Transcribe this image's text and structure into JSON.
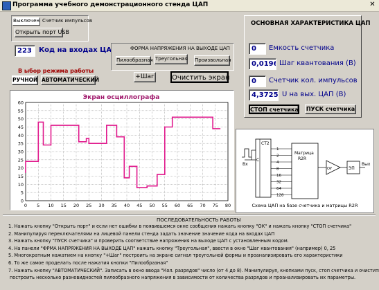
{
  "window": {
    "title": "Программа учебного демонстрационного стенда ЦАП",
    "close_glyph": "✕"
  },
  "tabs": {
    "active": "Выключен",
    "inactive": "Счетчик импульсов"
  },
  "open_port_label": "Открыть порт USB",
  "code_input": {
    "value": "223",
    "label": "Код на входах ЦАП"
  },
  "waveform": {
    "title": "ФОРМА НАПРЯЖЕНИЯ НА ВЫХОДЕ ЦАП",
    "options": [
      "Пилообразная",
      "Треугольная",
      "Произвольная"
    ]
  },
  "mode": {
    "title": "В ыбор режима работы",
    "manual": "РУЧНОЙ",
    "auto": "АВТОМАТИЧЕСКИЙ"
  },
  "step_button": "+Шаг",
  "clear_button": "Очистить экран",
  "main_char_title": "ОСНОВНАЯ ХАРАКТЕРИСТИКА ЦАП",
  "counter_capacity": {
    "value": "0",
    "label": "Емкость счетчика"
  },
  "quant_step": {
    "value": "0,01960",
    "label": "Шаг квантования (В)"
  },
  "pulse_count": {
    "value": "0",
    "label": "Счетчик кол. импульсов"
  },
  "output_voltage": {
    "value": "4,372549",
    "label": "U на вых. ЦАП (В)"
  },
  "stop_counter": "СТОП счетчика",
  "start_counter": "ПУСК счетчика",
  "circuit": {
    "input": "Вх",
    "counter": "СТ2",
    "c_pin": "С",
    "bits": [
      "1",
      "2",
      "4",
      "8",
      "16",
      "32",
      "64",
      "128"
    ],
    "matrix": "Матрица",
    "r2r": "R2R",
    "amp": "ОУ",
    "ep": "ЭП",
    "out": "Вых",
    "caption": "Схема ЦАП на базе счетчика и матрицы R2R"
  },
  "chart_data": {
    "type": "line",
    "title": "Экран осциллографа",
    "xlim": [
      0,
      80
    ],
    "ylim": [
      0,
      60
    ],
    "xticks": [
      0,
      5,
      10,
      15,
      20,
      25,
      30,
      35,
      40,
      45,
      50,
      55,
      60,
      65,
      70,
      75,
      80
    ],
    "yticks": [
      0,
      5,
      10,
      15,
      20,
      25,
      30,
      35,
      40,
      45,
      50,
      55,
      60
    ],
    "grid": true,
    "series": [
      {
        "color": "#e0188c",
        "points": [
          [
            0,
            17
          ],
          [
            0,
            24
          ],
          [
            5,
            24
          ],
          [
            5,
            40
          ],
          [
            5,
            48
          ],
          [
            7,
            48
          ],
          [
            7,
            34
          ],
          [
            10,
            34
          ],
          [
            10,
            46
          ],
          [
            21,
            46
          ],
          [
            21,
            36
          ],
          [
            24,
            36
          ],
          [
            24,
            38
          ],
          [
            25,
            38
          ],
          [
            25,
            35
          ],
          [
            32,
            35
          ],
          [
            32,
            46
          ],
          [
            36,
            46
          ],
          [
            36,
            39
          ],
          [
            39,
            39
          ],
          [
            39,
            14
          ],
          [
            41,
            14
          ],
          [
            41,
            21
          ],
          [
            44,
            21
          ],
          [
            44,
            8
          ],
          [
            48,
            8
          ],
          [
            48,
            9
          ],
          [
            52,
            9
          ],
          [
            52,
            16
          ],
          [
            55,
            16
          ],
          [
            55,
            45
          ],
          [
            58,
            45
          ],
          [
            58,
            51
          ],
          [
            74,
            51
          ],
          [
            74,
            44
          ],
          [
            77,
            44
          ]
        ]
      }
    ]
  },
  "instructions": {
    "title": "ПОСЛЕДОВАТЕЛЬНОСТЬ РАБОТЫ",
    "lines": [
      "1. Нажать кнопку \"Открыть порт\" и если нет ошибки в появившемся окне сообщения нажать кнопку \"ОК\" и нажать кнопку \"СТОП счетчика\"",
      "2. Манипулируя переключателями на лицевой панели стенда задать значение значение кода на входах ЦАП",
      "3. Нажать кнопку \"ПУСК счетчика\" и проверить соответствие напряжения на выходе ЦАП с установленным кодом.",
      "4. На панели \"ФРМА НАПРЯЖЕНИЯ НА ВЫХОДЕ ЦАП\" нажать кнопку \"Треугольная\", ввести в окно \"Шаг квантования\" (например) 0, 25",
      "5. Многократным нажатием на кнопку \"+Шаг\" построить на экране сигнал треугольной формы и проанализировать его характеристики",
      "6. То же самое проделать после нажатия кнопки \"Пилообразная\"",
      "7. Нажать кнопку \"АВТОМАТИЧЕСКИЙ\". Записать в окно ввода \"Кол. разрядов\" число (от 4 до 8). Манипулируя, кнопками пуск, стоп счетчика и очистить экран",
      "построить несколько разновидностей пилообразного напряжения в зависимости от количества разрядов и проанализировать их параметры."
    ]
  }
}
